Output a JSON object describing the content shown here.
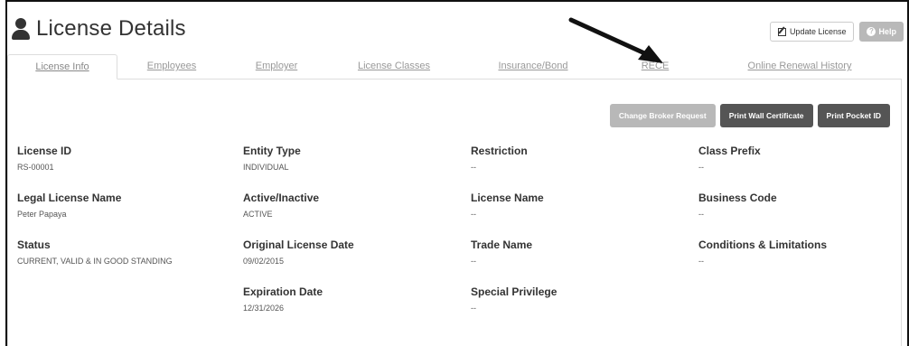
{
  "header": {
    "title": "License Details",
    "update_label": "Update License",
    "help_label": "Help"
  },
  "tabs": [
    {
      "label": "License Info",
      "active": true
    },
    {
      "label": "Employees",
      "active": false
    },
    {
      "label": "Employer",
      "active": false
    },
    {
      "label": "License Classes",
      "active": false
    },
    {
      "label": "Insurance/Bond",
      "active": false
    },
    {
      "label": "RECE",
      "active": false
    },
    {
      "label": "Online Renewal History",
      "active": false
    }
  ],
  "actions": {
    "change_broker": "Change Broker Request",
    "print_wall": "Print Wall Certificate",
    "print_pocket": "Print Pocket ID"
  },
  "fields": {
    "license_id": {
      "label": "License ID",
      "value": "RS-00001"
    },
    "legal_name": {
      "label": "Legal License Name",
      "value": "Peter Papaya"
    },
    "status": {
      "label": "Status",
      "value": "CURRENT, VALID & IN GOOD STANDING"
    },
    "entity_type": {
      "label": "Entity Type",
      "value": "INDIVIDUAL"
    },
    "active_inactive": {
      "label": "Active/Inactive",
      "value": "ACTIVE"
    },
    "original_date": {
      "label": "Original License Date",
      "value": "09/02/2015"
    },
    "expiration_date": {
      "label": "Expiration Date",
      "value": "12/31/2026"
    },
    "restriction": {
      "label": "Restriction",
      "value": "--"
    },
    "license_name": {
      "label": "License Name",
      "value": "--"
    },
    "trade_name": {
      "label": "Trade Name",
      "value": "--"
    },
    "special_privilege": {
      "label": "Special Privilege",
      "value": "--"
    },
    "class_prefix": {
      "label": "Class Prefix",
      "value": "--"
    },
    "business_code": {
      "label": "Business Code",
      "value": "--"
    },
    "conditions": {
      "label": "Conditions & Limitations",
      "value": "--"
    }
  },
  "colors": {
    "accent_dark": "#555555",
    "disabled": "#b8b8b8",
    "tab_text": "#999999"
  }
}
